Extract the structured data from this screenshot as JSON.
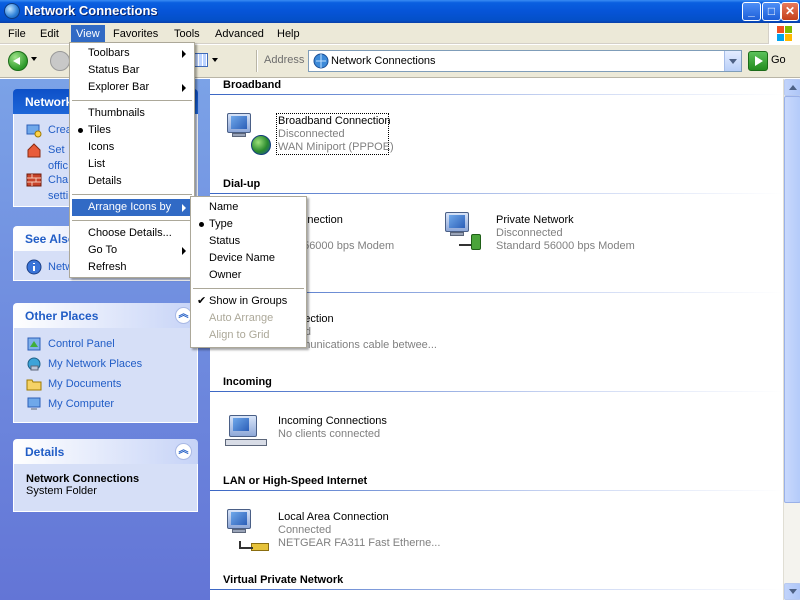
{
  "window": {
    "title": "Network Connections",
    "controls": {
      "minimize": "_",
      "maximize": "□",
      "close": "✕"
    }
  },
  "menubar": {
    "items": [
      {
        "label": "File"
      },
      {
        "label": "Edit"
      },
      {
        "label": "View"
      },
      {
        "label": "Favorites"
      },
      {
        "label": "Tools"
      },
      {
        "label": "Advanced"
      },
      {
        "label": "Help"
      }
    ]
  },
  "toolbar": {
    "address_label": "Address",
    "address_value": "Network Connections",
    "go_label": "Go"
  },
  "view_menu": {
    "items": [
      {
        "label": "Toolbars",
        "submenu": true
      },
      {
        "label": "Status Bar"
      },
      {
        "label": "Explorer Bar",
        "submenu": true
      },
      {
        "label": "Thumbnails"
      },
      {
        "label": "Tiles",
        "checked": "bullet"
      },
      {
        "label": "Icons"
      },
      {
        "label": "List"
      },
      {
        "label": "Details"
      },
      {
        "label": "Arrange Icons by",
        "submenu": true,
        "highlighted": true
      },
      {
        "label": "Choose Details..."
      },
      {
        "label": "Go To",
        "submenu": true
      },
      {
        "label": "Refresh"
      }
    ]
  },
  "arrange_menu": {
    "items": [
      {
        "label": "Name"
      },
      {
        "label": "Type",
        "checked": "bullet"
      },
      {
        "label": "Status"
      },
      {
        "label": "Device Name"
      },
      {
        "label": "Owner"
      },
      {
        "label": "Show in Groups",
        "checked": "check"
      },
      {
        "label": "Auto Arrange",
        "disabled": true
      },
      {
        "label": "Align to Grid",
        "disabled": true
      }
    ]
  },
  "taskpane": {
    "network_tasks": {
      "title": "Network",
      "links": [
        "Crea",
        "Set",
        "offic",
        "Cha",
        "setti"
      ]
    },
    "see_also": {
      "title": "See Also",
      "links": [
        "Netw"
      ]
    },
    "other_places": {
      "title": "Other Places",
      "links": [
        "Control Panel",
        "My Network Places",
        "My Documents",
        "My Computer"
      ]
    },
    "details": {
      "title": "Details",
      "name": "Network Connections",
      "type": "System Folder"
    }
  },
  "groups": {
    "broadband": {
      "heading": "Broadband",
      "items": [
        {
          "name": "Broadband Connection",
          "status": "Disconnected",
          "device": "WAN Miniport (PPPOE)"
        }
      ]
    },
    "dialup": {
      "heading": "Dial-up",
      "items": [
        {
          "name": "p Connection",
          "status": "cted",
          "device": "dard 56000 bps Modem"
        },
        {
          "name": "Private Network",
          "status": "Disconnected",
          "device": "Standard 56000 bps Modem"
        }
      ]
    },
    "direct": {
      "items": [
        {
          "name": "Connection",
          "status": "nected",
          "device": "Communications cable betwee..."
        }
      ]
    },
    "incoming": {
      "heading": "Incoming",
      "items": [
        {
          "name": "Incoming Connections",
          "status": "No clients connected"
        }
      ]
    },
    "lan": {
      "heading": "LAN or High-Speed Internet",
      "items": [
        {
          "name": "Local Area Connection",
          "status": "Connected",
          "device": "NETGEAR FA311 Fast Etherne..."
        }
      ]
    },
    "vpn": {
      "heading": "Virtual Private Network"
    }
  },
  "colors": {
    "title_bar": "#0654d7",
    "menu_highlight": "#316ac5",
    "taskpane_top": "#7ba2e7",
    "taskpane_bottom": "#6375d6",
    "link_blue": "#215dc6",
    "group_line": "#3a66c4"
  }
}
